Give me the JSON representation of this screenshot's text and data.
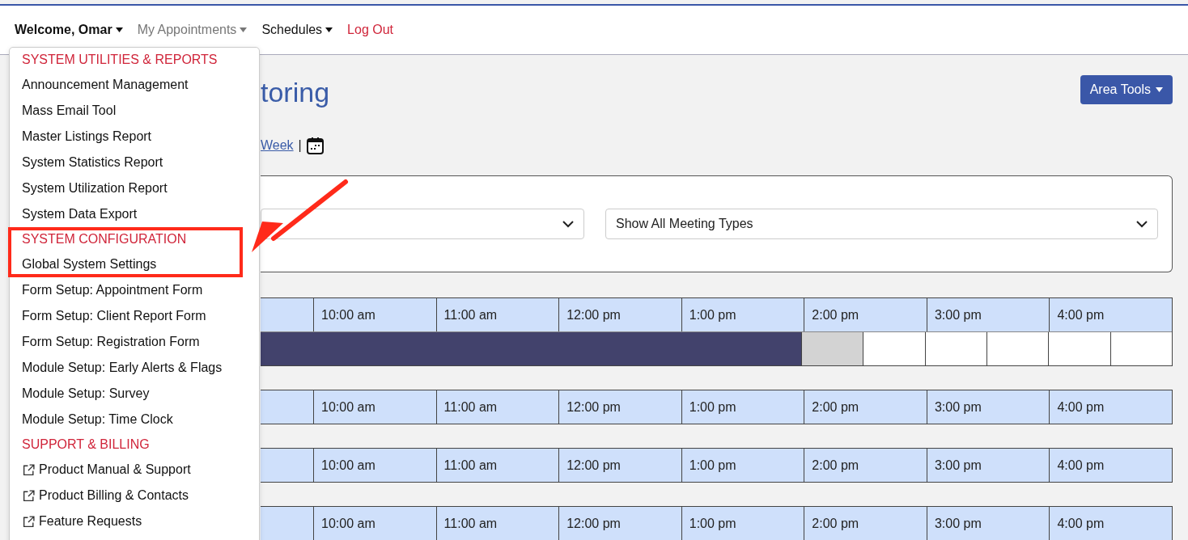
{
  "nav": [
    {
      "label": "Welcome, Omar",
      "kind": "user",
      "caret": true
    },
    {
      "label": "My Appointments",
      "kind": "muted",
      "caret": true
    },
    {
      "label": "Schedules",
      "kind": "menu",
      "caret": true
    },
    {
      "label": "Log Out",
      "kind": "logout",
      "caret": false
    }
  ],
  "dropdown": {
    "sections": [
      {
        "header": "SYSTEM UTILITIES & REPORTS",
        "highlighted": false,
        "items": [
          {
            "label": "Announcement Management",
            "external": false
          },
          {
            "label": "Mass Email Tool",
            "external": false
          },
          {
            "label": "Master Listings Report",
            "external": false
          },
          {
            "label": "System Statistics Report",
            "external": false
          },
          {
            "label": "System Utilization Report",
            "external": false
          },
          {
            "label": "System Data Export",
            "external": false
          }
        ]
      },
      {
        "header": "SYSTEM CONFIGURATION",
        "highlighted": true,
        "items": [
          {
            "label": "Global System Settings",
            "external": false
          },
          {
            "label": "Form Setup: Appointment Form",
            "external": false
          },
          {
            "label": "Form Setup: Client Report Form",
            "external": false
          },
          {
            "label": "Form Setup: Registration Form",
            "external": false
          },
          {
            "label": "Module Setup: Early Alerts & Flags",
            "external": false
          },
          {
            "label": "Module Setup: Survey",
            "external": false
          },
          {
            "label": "Module Setup: Time Clock",
            "external": false
          }
        ]
      },
      {
        "header": "SUPPORT & BILLING",
        "highlighted": false,
        "items": [
          {
            "label": "Product Manual & Support",
            "external": true
          },
          {
            "label": "Product Billing & Contacts",
            "external": true
          },
          {
            "label": "Feature Requests",
            "external": true
          }
        ]
      }
    ]
  },
  "page_title": "toring",
  "area_tools": "Area Tools",
  "week_link": "Week",
  "separator": "|",
  "filter": {
    "meeting_type": "Show All Meeting Types"
  },
  "schedules": [
    {
      "times": [
        "10:00 am",
        "11:00 am",
        "12:00 pm",
        "1:00 pm",
        "2:00 pm",
        "3:00 pm",
        "4:00 pm"
      ],
      "slots": [
        {
          "kind": "booked"
        },
        {
          "kind": "booked"
        },
        {
          "kind": "booked"
        },
        {
          "kind": "booked"
        },
        {
          "kind": "booked"
        },
        {
          "kind": "booked"
        },
        {
          "kind": "booked"
        },
        {
          "kind": "booked"
        },
        {
          "kind": "booked"
        },
        {
          "kind": "unavailable"
        },
        {
          "kind": "open"
        },
        {
          "kind": "open"
        },
        {
          "kind": "open"
        },
        {
          "kind": "open"
        },
        {
          "kind": "open"
        }
      ]
    },
    {
      "times": [
        "10:00 am",
        "11:00 am",
        "12:00 pm",
        "1:00 pm",
        "2:00 pm",
        "3:00 pm",
        "4:00 pm"
      ]
    },
    {
      "times": [
        "10:00 am",
        "11:00 am",
        "12:00 pm",
        "1:00 pm",
        "2:00 pm",
        "3:00 pm",
        "4:00 pm"
      ]
    },
    {
      "times": [
        "10:00 am",
        "11:00 am",
        "12:00 pm",
        "1:00 pm",
        "2:00 pm",
        "3:00 pm",
        "4:00 pm"
      ]
    }
  ],
  "annotation": {
    "arrow": true
  }
}
